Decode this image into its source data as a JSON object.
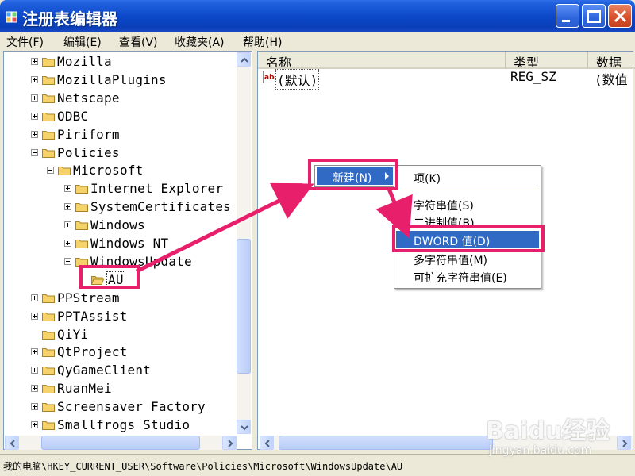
{
  "window": {
    "title": "注册表编辑器",
    "app_icon": "regedit-icon"
  },
  "menu": [
    "文件(F)",
    "编辑(E)",
    "查看(V)",
    "收藏夹(A)",
    "帮助(H)"
  ],
  "tree": [
    {
      "label": "Mozilla",
      "expander": "plus"
    },
    {
      "label": "MozillaPlugins",
      "expander": "plus"
    },
    {
      "label": "Netscape",
      "expander": "plus"
    },
    {
      "label": "ODBC",
      "expander": "plus"
    },
    {
      "label": "Piriform",
      "expander": "plus"
    },
    {
      "label": "Policies",
      "expander": "minus"
    },
    {
      "label": "Microsoft",
      "expander": "minus"
    },
    {
      "label": "Internet Explorer",
      "expander": "plus"
    },
    {
      "label": "SystemCertificates",
      "expander": "plus"
    },
    {
      "label": "Windows",
      "expander": "plus"
    },
    {
      "label": "Windows NT",
      "expander": "plus"
    },
    {
      "label": "WindowsUpdate",
      "expander": "minus"
    },
    {
      "label": "AU",
      "expander": "none",
      "selected": true
    },
    {
      "label": "PPStream",
      "expander": "plus"
    },
    {
      "label": "PPTAssist",
      "expander": "plus"
    },
    {
      "label": "QiYi",
      "expander": "none"
    },
    {
      "label": "QtProject",
      "expander": "plus"
    },
    {
      "label": "QyGameClient",
      "expander": "plus"
    },
    {
      "label": "RuanMei",
      "expander": "plus"
    },
    {
      "label": "Screensaver Factory",
      "expander": "plus"
    },
    {
      "label": "Smallfrogs Studio",
      "expander": "plus"
    }
  ],
  "list": {
    "columns": [
      "名称",
      "类型",
      "数据"
    ],
    "rows": [
      {
        "name": "(默认)",
        "type": "REG_SZ",
        "data": "(数值"
      }
    ]
  },
  "context_menu": {
    "new_label": "新建(N)",
    "submenu": {
      "key": "项(K)",
      "string": "字符串值(S)",
      "binary": "二进制值(B)",
      "dword": "DWORD 值(D)",
      "multi": "多字符串值(M)",
      "expand": "可扩充字符串值(E)"
    }
  },
  "status": "我的电脑\\HKEY_CURRENT_USER\\Software\\Policies\\Microsoft\\WindowsUpdate\\AU",
  "watermark": {
    "logo": "Baidu经验",
    "url": "jingyan.baidu.com"
  },
  "colors": {
    "titlebar": "#0a47c8",
    "highlight": "#e8206b",
    "selection": "#316ac5",
    "folder": "#f5d36a"
  }
}
